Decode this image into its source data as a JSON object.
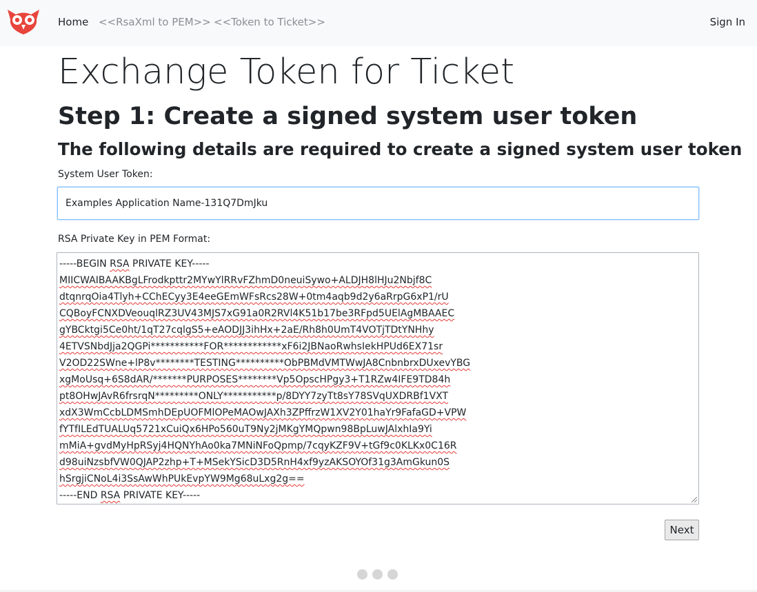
{
  "nav": {
    "home": "Home",
    "rsa_to_pem": "<<RsaXml to PEM>>",
    "token_to_ticket": "<<Token to Ticket>>",
    "sign_in": "Sign In"
  },
  "page": {
    "title": "Exchange Token for Ticket",
    "step_heading": "Step 1: Create a signed system user token",
    "subheading": "The following details are required to create a signed system user token"
  },
  "form": {
    "token_label": "System User Token:",
    "token_value": "Examples Application Name-131Q7DmJku",
    "key_label": "RSA Private Key in PEM Format:",
    "key_lines": [
      "-----BEGIN RSA PRIVATE KEY-----",
      "MIICWAIBAAKBgLFrodkpttr2MYwYlRRvFZhmD0neuiSywo+ALDJH8lHJu2Nbjf8C",
      "dtqnrqOia4Tlyh+CChECyy3E4eeGEmWFsRcs28W+0tm4aqb9d2y6aRrpG6xP1/rU",
      "CQBoyFCNXDVeouqlRZ3UV43MJS7xG91a0R2RVl4K51b17be3RFpd5UElAgMBAAEC",
      "gYBCktgi5Ce0ht/1qT27cqlgS5+eAODJJ3ihHx+2aE/Rh8h0UmT4VOTjTDtYNHhy",
      "4ETVSNbdJja2QGPi***********FOR************xF6i2JBNaoRwhsIekHPUd6EX71sr",
      "V2OD22SWne+lP8v********TESTING**********ObPBMdVMTWwJA8CnbnbrxDUxevYBG",
      "xgMoUsq+6S8dAR/*******PURPOSES********Vp5OpscHPgy3+T1RZw4IFE9TD84h",
      "pt8OHwJAvR6frsrqN*********ONLY***********p/8DYY7zyTt8sY78SVqUXDRBf1VXT",
      "xdX3WmCcbLDMSmhDEpUOFMlOPeMAOwJAXh3ZPffrzW1XV2Y01haYr9FafaGD+VPW",
      "fYTfILEdTUALUq5721xCuiQx6HPo560uT9Ny2jMKgYMQpwn98BpLuwJAlxhIa9Yi",
      "mMiA+gvdMyHpRSyj4HQNYhAo0ka7MNiNFoQpmp/7cqyKZF9V+tGf9c0KLKx0C16R",
      "d98uiNzsbfVW0QJAP2zhp+T+MSekYSicD3D5RnH4xf9yzAKSOYOf31g3AmGkun0S",
      "hSrgjiCNoL4i3SsAwWhPUkEvpYW9Mg68uLxg2g==",
      "-----END RSA PRIVATE KEY-----"
    ],
    "next_label": "Next"
  },
  "colors": {
    "navbar_bg": "#f8f9fa",
    "logo_red": "#e8453c",
    "nav_muted": "#8a8f94",
    "input_focus_border": "#80bdff",
    "spellcheck_underline": "#e53935"
  },
  "icons": {
    "logo": "owl-logo-icon",
    "resize": "resize-grip-icon"
  },
  "loading_indicator": {
    "dot_count": 3
  }
}
